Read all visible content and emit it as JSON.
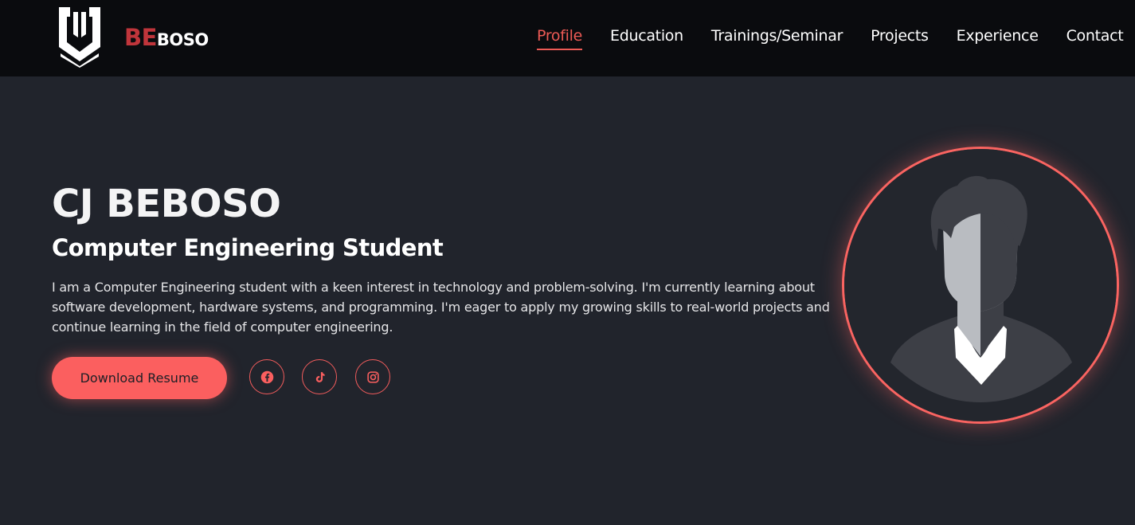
{
  "brand": {
    "prefix": "BE",
    "suffix": "BOSO",
    "accent_color": "#c0353b"
  },
  "nav": {
    "items": [
      {
        "label": "Profile",
        "active": true
      },
      {
        "label": "Education"
      },
      {
        "label": "Trainings/Seminar"
      },
      {
        "label": "Projects"
      },
      {
        "label": "Experience"
      },
      {
        "label": "Contact"
      }
    ]
  },
  "hero": {
    "name": "CJ BEBOSO",
    "role": "Computer Engineering Student",
    "bio": "I am a Computer Engineering student with a keen interest in technology and problem-solving. I'm currently learning about software development, hardware systems, and programming. I'm eager to apply my growing skills to real-world projects and continue learning in the field of computer engineering.",
    "resume_label": "Download Resume",
    "socials": [
      {
        "icon": "facebook-icon"
      },
      {
        "icon": "tiktok-icon"
      },
      {
        "icon": "instagram-icon"
      }
    ]
  },
  "colors": {
    "accent": "#fb5f5f",
    "background": "#21242c",
    "header": "#0a0b0e"
  }
}
